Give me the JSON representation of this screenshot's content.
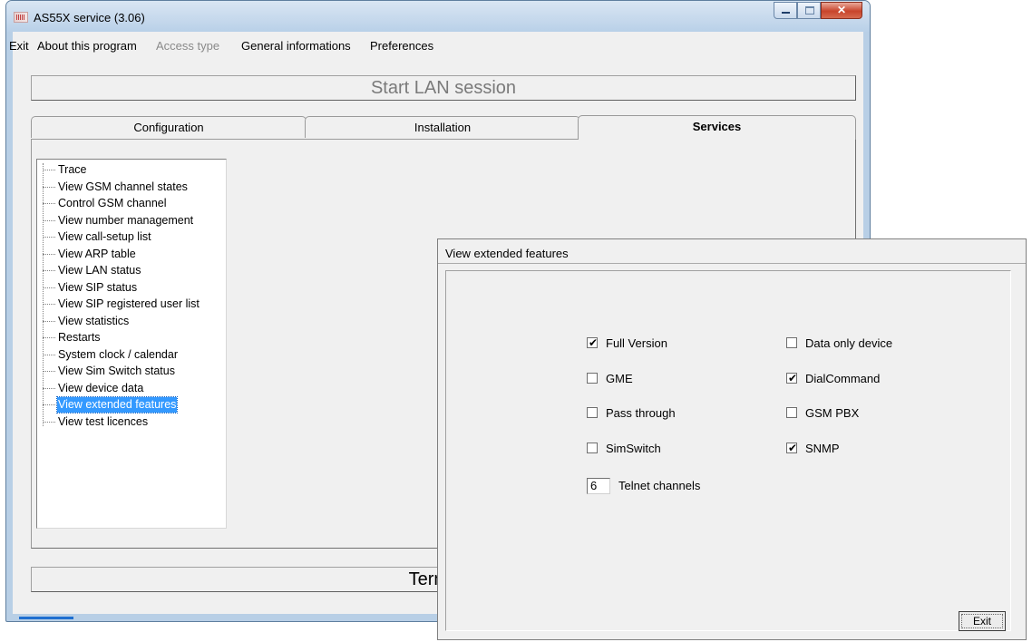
{
  "window": {
    "title": "AS55X service (3.06)",
    "icon": "app-icon",
    "caption_buttons": [
      "minimize-icon",
      "maximize-icon",
      "close-icon"
    ]
  },
  "menu": {
    "items": [
      {
        "label": "Exit",
        "enabled": true
      },
      {
        "label": "About this program",
        "enabled": true
      },
      {
        "label": "Access type",
        "enabled": false
      },
      {
        "label": "General informations",
        "enabled": true
      },
      {
        "label": "Preferences",
        "enabled": true
      }
    ]
  },
  "start_button": "Start LAN session",
  "terminate_button": "Terminat",
  "tabs": [
    {
      "label": "Configuration",
      "active": false
    },
    {
      "label": "Installation",
      "active": false
    },
    {
      "label": "Services",
      "active": true
    }
  ],
  "tree": {
    "items": [
      "Trace",
      "View GSM channel states",
      "Control GSM channel",
      "View number management",
      "View call-setup list",
      "View ARP table",
      "View LAN status",
      "View SIP status",
      "View SIP registered user list",
      "View statistics",
      "Restarts",
      "System clock / calendar",
      "View Sim Switch status",
      "View device data",
      "View extended features",
      "View test licences"
    ],
    "selected": "View extended features"
  },
  "dialog": {
    "title": "View extended features",
    "checkboxes_left": [
      {
        "label": "Full Version",
        "checked": true
      },
      {
        "label": "GME",
        "checked": false
      },
      {
        "label": "Pass through",
        "checked": false
      },
      {
        "label": "SimSwitch",
        "checked": false
      }
    ],
    "checkboxes_right": [
      {
        "label": "Data only device",
        "checked": false
      },
      {
        "label": "DialCommand",
        "checked": true
      },
      {
        "label": "GSM PBX",
        "checked": false
      },
      {
        "label": "SNMP",
        "checked": true
      }
    ],
    "telnet_value": "6",
    "telnet_label": "Telnet channels",
    "exit_label": "Exit"
  },
  "colors": {
    "selection": "#3399ff",
    "window_frame": "#b8cfe6",
    "close_button": "#c8442b"
  }
}
